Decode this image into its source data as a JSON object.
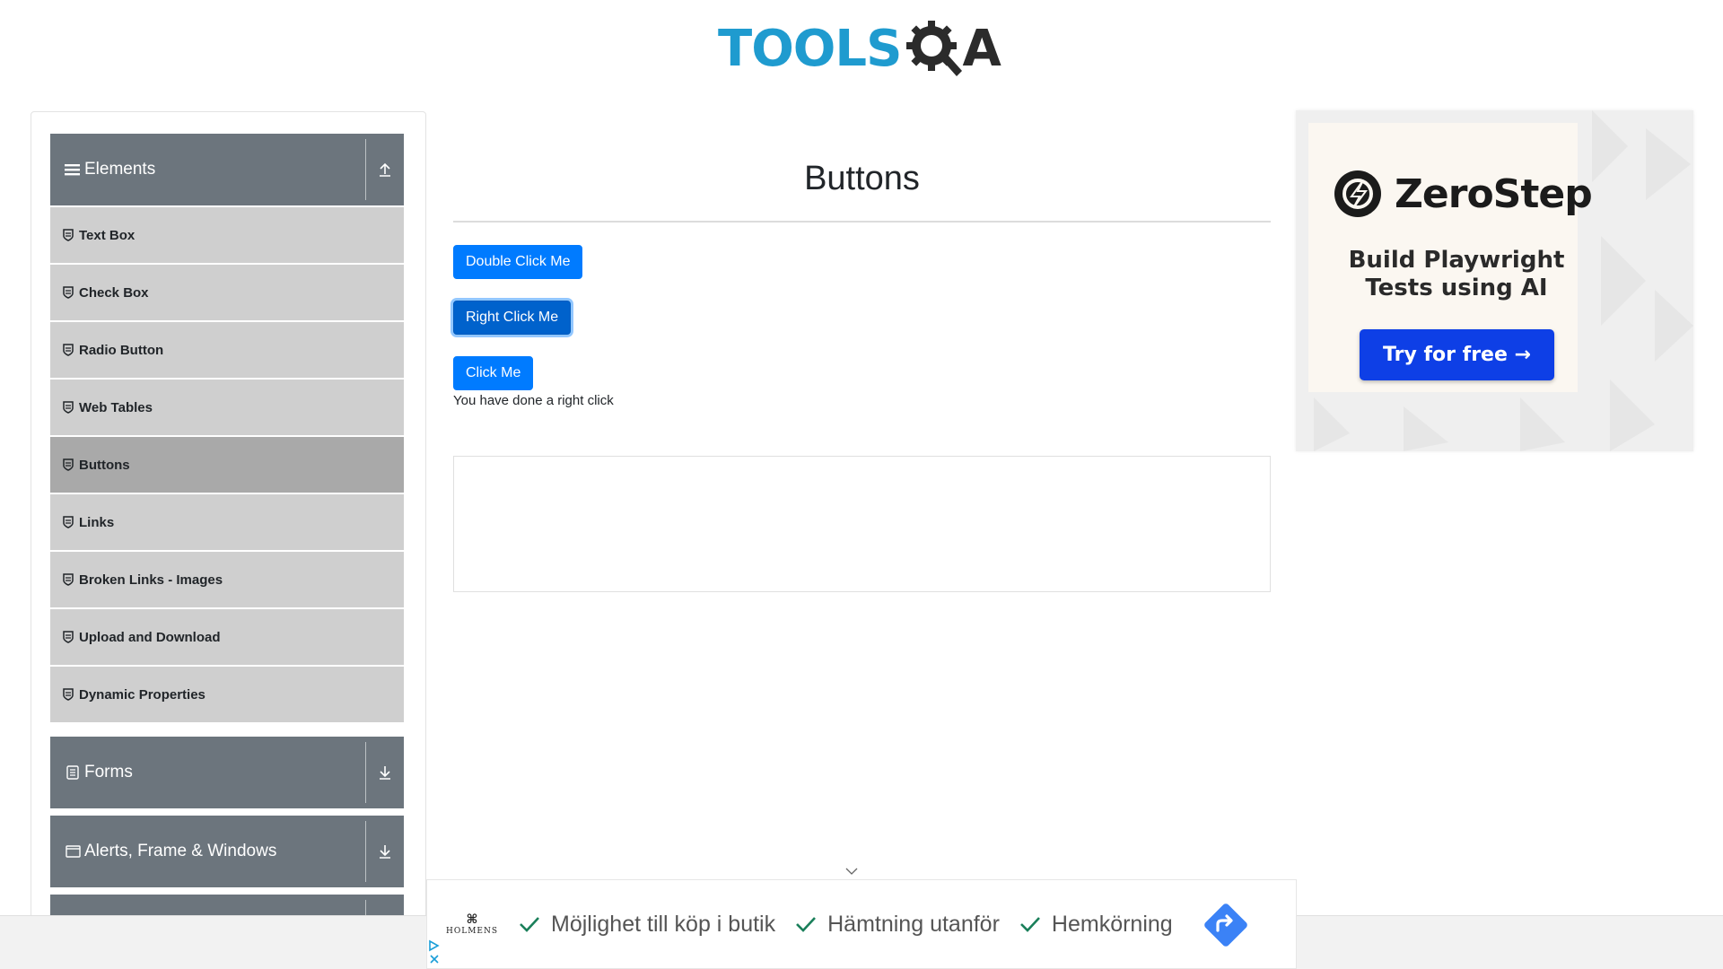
{
  "header": {
    "logo_left": "TOOLS",
    "logo_right": "A"
  },
  "sidebar": {
    "elements_group": "Elements",
    "items": [
      {
        "label": "Text Box"
      },
      {
        "label": "Check Box"
      },
      {
        "label": "Radio Button"
      },
      {
        "label": "Web Tables"
      },
      {
        "label": "Buttons",
        "active": true
      },
      {
        "label": "Links"
      },
      {
        "label": "Broken Links - Images"
      },
      {
        "label": "Upload and Download"
      },
      {
        "label": "Dynamic Properties"
      }
    ],
    "forms_group": "Forms",
    "alerts_group": "Alerts, Frame & Windows"
  },
  "main": {
    "title": "Buttons",
    "double_click_label": "Double Click Me",
    "right_click_label": "Right Click Me",
    "click_label": "Click Me",
    "result_message": "You have done a right click"
  },
  "ad_right": {
    "brand": "ZeroStep",
    "tagline_line1": "Build Playwright",
    "tagline_line2": "Tests using AI",
    "cta": "Try for free →"
  },
  "ad_bottom": {
    "logo_text": "HOLMENS",
    "features": [
      "Möjlighet till köp i butik",
      "Hämtning utanför",
      "Hemkörning"
    ]
  },
  "colors": {
    "primary": "#007bff",
    "sidebar_header": "#6c757d",
    "sidebar_item": "#cfcfcf",
    "sidebar_item_active": "#a9a9a9",
    "logo_blue": "#1f9bcf",
    "ad_cta": "#0e3fe6",
    "check_green": "#1a7f5a"
  }
}
